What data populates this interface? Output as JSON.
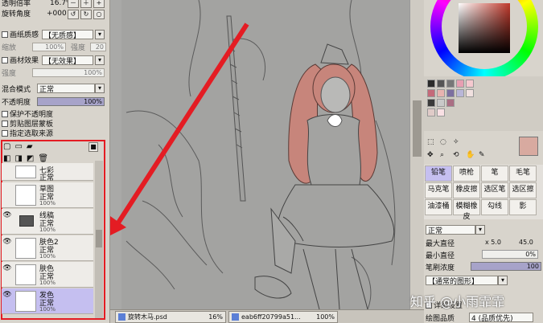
{
  "left_panel": {
    "top_field1_label": "透明倍率",
    "top_field1_value": "16.7%",
    "top_field2_label": "旋转角度",
    "top_field2_value": "+000",
    "paper_texture_label": "画纸质感",
    "paper_texture_value": "【无质感】",
    "scale_label": "缩放",
    "scale_value": "100%",
    "strength_label": "强度",
    "strength_value": "20",
    "material_label": "画材效果",
    "material_value": "【无效果】",
    "material_scale_label": "强度",
    "material_scale_value": "100%",
    "blend_label": "混合模式",
    "blend_value": "正常",
    "opacity_label": "不透明度",
    "opacity_value": "100%",
    "check1": "保护不透明度",
    "check2": "剪贴图层蒙板",
    "check3": "指定选取来源",
    "layers": [
      {
        "name": "七彩",
        "mode": "正常",
        "opacity": ""
      },
      {
        "name": "草图",
        "mode": "正常",
        "opacity": "100%"
      },
      {
        "name": "线稿",
        "mode": "正常",
        "opacity": "100%"
      },
      {
        "name": "肤色2",
        "mode": "正常",
        "opacity": "100%"
      },
      {
        "name": "肤色",
        "mode": "正常",
        "opacity": "100%"
      },
      {
        "name": "发色",
        "mode": "正常",
        "opacity": "100%"
      }
    ]
  },
  "tabs": [
    {
      "label": "旋转木马.psd",
      "pct": "16%"
    },
    {
      "label": "eab6ff20799a51...",
      "pct": "100%"
    }
  ],
  "right_panel": {
    "tools": [
      "铅笔",
      "喷枪",
      "笔",
      "毛笔",
      "马克笔",
      "橡皮擦",
      "选区笔",
      "选区擦",
      "油漆桶",
      "模糊橡皮",
      "勾线",
      "影"
    ],
    "mode": "正常",
    "max_diameter_label": "最大直径",
    "max_diameter_mult": "x 5.0",
    "max_diameter_value": "45.0",
    "min_diameter_label": "最小直径",
    "min_diameter_value": "0%",
    "density_label": "笔刷浓度",
    "density_value": "100",
    "shape_label": "【通常的图形】",
    "detail_label": "详细设置",
    "quality_label": "绘图品质",
    "quality_value": "4 (品质优先)"
  },
  "watermark": "知乎 @小雨霏霏",
  "colors": {
    "accent_red": "#e41c23",
    "layer_selected": "#c5bff0",
    "canvas_bg": "#a9a9a7",
    "current_color": "#d8aaa0"
  }
}
